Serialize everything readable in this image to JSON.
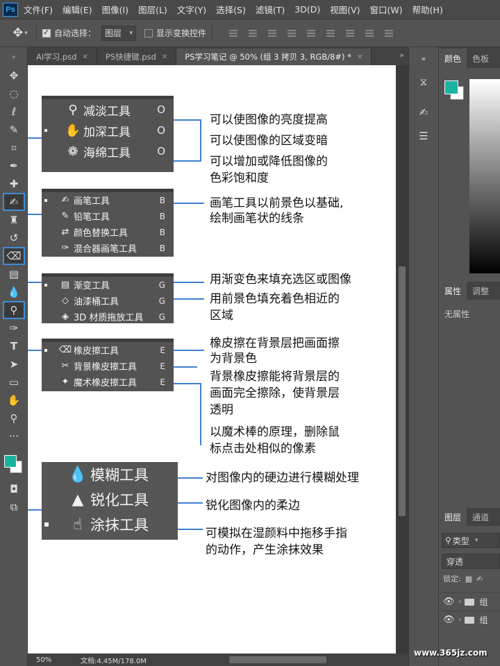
{
  "app": {
    "logo": "Ps"
  },
  "menu": [
    "文件(F)",
    "编辑(E)",
    "图像(I)",
    "图层(L)",
    "文字(Y)",
    "选择(S)",
    "滤镜(T)",
    "3D(D)",
    "视图(V)",
    "窗口(W)",
    "帮助(H)"
  ],
  "options": {
    "auto_select_label": "自动选择：",
    "auto_select_value": "图层",
    "show_transform_label": "显示变换控件"
  },
  "tabs": [
    {
      "label": "AI学习.psd"
    },
    {
      "label": "PS快捷键.psd"
    },
    {
      "label": "PS学习笔记 @ 50% (组 3 拷贝 3, RGB/8#) *"
    }
  ],
  "tools": [
    "move",
    "ellipse-marquee",
    "lasso",
    "quick-select",
    "crop",
    "eyedropper",
    "healing",
    "brush",
    "clone-stamp",
    "history-brush",
    "eraser",
    "gradient",
    "blur",
    "dodge",
    "pen",
    "type",
    "path-select",
    "rectangle",
    "hand",
    "zoom",
    "more"
  ],
  "colors": {
    "foreground": "#1ab3a0",
    "background": "#ffffff",
    "accent": "#3f8ed8",
    "connector": "#3f7fd0"
  },
  "groups": {
    "dodge": {
      "items": [
        {
          "name": "减淡工具",
          "key": "O",
          "icon": "dodge-icon"
        },
        {
          "name": "加深工具",
          "key": "O",
          "icon": "burn-icon"
        },
        {
          "name": "海绵工具",
          "key": "O",
          "icon": "sponge-icon"
        }
      ],
      "notes": [
        "可以使图像的亮度提高",
        "可以使图像的区域变暗",
        "可以增加或降低图像的",
        "色彩饱和度"
      ]
    },
    "brush": {
      "items": [
        {
          "name": "画笔工具",
          "key": "B",
          "icon": "brush-icon"
        },
        {
          "name": "铅笔工具",
          "key": "B",
          "icon": "pencil-icon"
        },
        {
          "name": "颜色替换工具",
          "key": "B",
          "icon": "color-replace-icon"
        },
        {
          "name": "混合器画笔工具",
          "key": "B",
          "icon": "mixer-brush-icon"
        }
      ],
      "notes": [
        "画笔工具以前景色以基础,",
        "绘制画笔状的线条"
      ]
    },
    "gradient": {
      "items": [
        {
          "name": "渐变工具",
          "key": "G",
          "icon": "gradient-icon"
        },
        {
          "name": "油漆桶工具",
          "key": "G",
          "icon": "paint-bucket-icon"
        },
        {
          "name": "3D 材质拖放工具",
          "key": "G",
          "icon": "material-drop-icon"
        }
      ],
      "notes": [
        "用渐变色来填充选区或图像",
        "用前景色填充着色相近的",
        "区域"
      ]
    },
    "eraser": {
      "items": [
        {
          "name": "橡皮擦工具",
          "key": "E",
          "icon": "eraser-icon"
        },
        {
          "name": "背景橡皮擦工具",
          "key": "E",
          "icon": "background-eraser-icon"
        },
        {
          "name": "魔术橡皮擦工具",
          "key": "E",
          "icon": "magic-eraser-icon"
        }
      ],
      "notes": [
        "橡皮擦在背景层把画面擦",
        "为背景色",
        "背景橡皮擦能将背景层的",
        "画面完全擦除，使背景层",
        "透明",
        "以魔术棒的原理，删除鼠",
        "标点击处相似的像素"
      ]
    },
    "blur": {
      "items": [
        {
          "name": "模糊工具",
          "icon": "blur-drop-icon"
        },
        {
          "name": "锐化工具",
          "icon": "sharpen-icon"
        },
        {
          "name": "涂抹工具",
          "icon": "smudge-icon"
        }
      ],
      "notes": [
        "对图像内的硬边进行模糊处理",
        "锐化图像内的柔边",
        "可模拟在湿颜料中拖移手指",
        "的动作，产生涂抹效果"
      ]
    }
  },
  "status": {
    "zoom": "50%",
    "doc": "文档:4.45M/178.0M"
  },
  "right": {
    "color_tabs": [
      "颜色",
      "色板"
    ],
    "props_tabs": [
      "属性",
      "调整"
    ],
    "props_empty": "无属性",
    "layers_tabs": [
      "图层",
      "通道"
    ],
    "filter_kind": "类型",
    "blend_mode": "穿透",
    "lock_label": "锁定:",
    "layers": [
      "组",
      "组"
    ]
  },
  "watermark": "www.365jz.com"
}
